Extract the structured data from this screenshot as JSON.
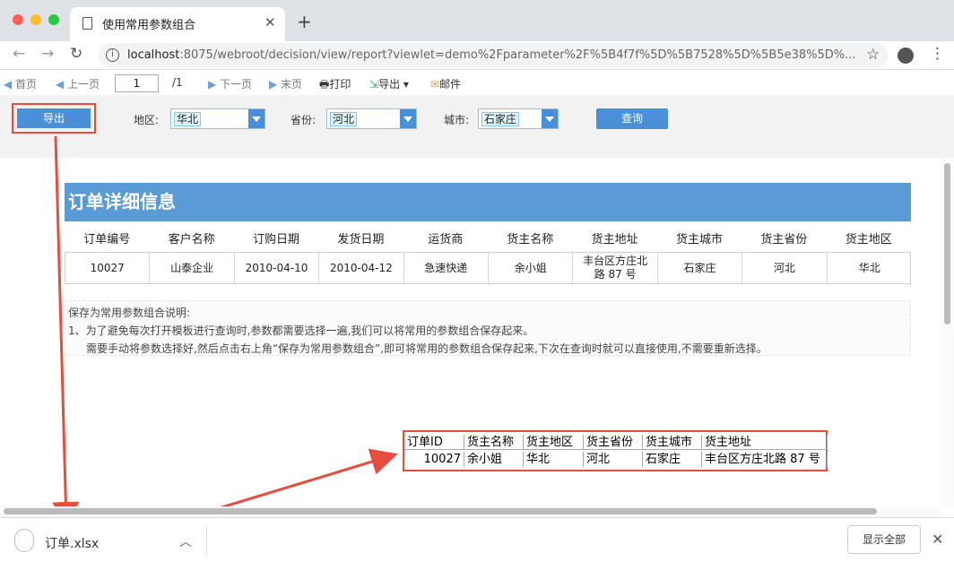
{
  "browser": {
    "tab_title": "使用常用参数组合",
    "url_host": "localhost",
    "url_rest": ":8075/webroot/decision/view/report?viewlet=demo%2Fparameter%2F%5B4f7f%5D%5B7528%5D%5B5e38%5D%..."
  },
  "toolbar": {
    "first": "首页",
    "prev": "上一页",
    "page": "1",
    "total": "/1",
    "next": "下一页",
    "last": "末页",
    "print": "打印",
    "export": "导出",
    "mail": "邮件"
  },
  "params": {
    "export_button": "导出",
    "region_label": "地区:",
    "region_value": "华北",
    "province_label": "省份:",
    "province_value": "河北",
    "city_label": "城市:",
    "city_value": "石家庄",
    "query_button": "查询"
  },
  "report": {
    "title": "订单详细信息",
    "headers": [
      "订单编号",
      "客户名称",
      "订购日期",
      "发货日期",
      "运货商",
      "货主名称",
      "货主地址",
      "货主城市",
      "货主省份",
      "货主地区"
    ],
    "row": [
      "10027",
      "山泰企业",
      "2010-04-10",
      "2010-04-12",
      "急速快递",
      "余小姐",
      "丰台区方庄北路 87 号",
      "石家庄",
      "河北",
      "华北"
    ],
    "note_title": "保存为常用参数组合说明:",
    "note_line1": "1、为了避免每次打开模板进行查询时,参数都需要选择一遍,我们可以将常用的参数组合保存起来。",
    "note_line2": "需要手动将参数选择好,然后点击右上角“保存为常用参数组合”,即可将常用的参数组合保存起来,下次在查询时就可以直接使用,不需要重新选择。"
  },
  "excel": {
    "headers": [
      "订单ID",
      "货主名称",
      "货主地区",
      "货主省份",
      "货主城市",
      "货主地址"
    ],
    "row": [
      "10027",
      "余小姐",
      "华北",
      "河北",
      "石家庄",
      "丰台区方庄北路 87 号"
    ]
  },
  "downloads": {
    "file_name": "订单.xlsx",
    "show_all": "显示全部"
  },
  "colors": {
    "accent": "#4a90d9",
    "title_bar": "#5b9bd5",
    "highlight": "#e84c3d"
  }
}
